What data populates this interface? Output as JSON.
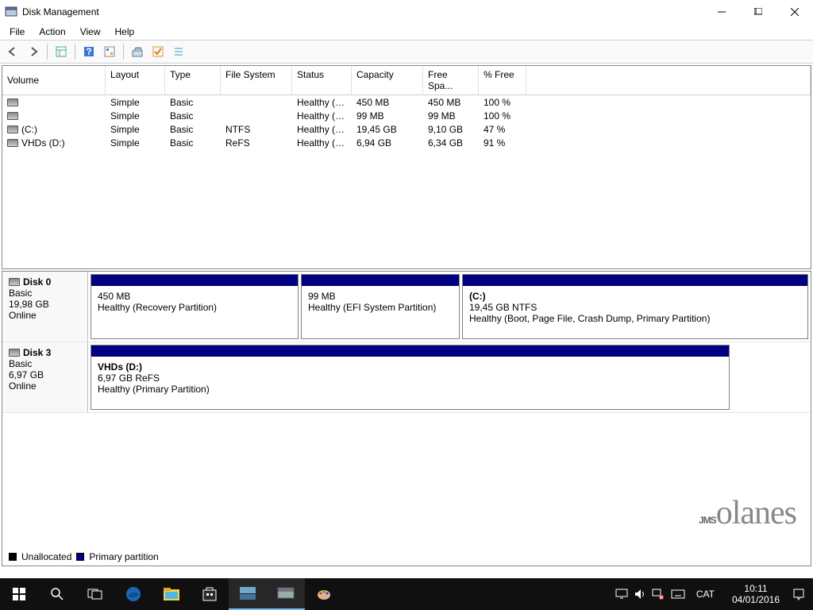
{
  "titlebar": {
    "title": "Disk Management"
  },
  "menu": {
    "file": "File",
    "action": "Action",
    "view": "View",
    "help": "Help"
  },
  "columns": {
    "volume": "Volume",
    "layout": "Layout",
    "type": "Type",
    "fs": "File System",
    "status": "Status",
    "capacity": "Capacity",
    "free": "Free Spa...",
    "pct": "% Free"
  },
  "volumes": [
    {
      "name": "",
      "layout": "Simple",
      "type": "Basic",
      "fs": "",
      "status": "Healthy (R...",
      "capacity": "450 MB",
      "free": "450 MB",
      "pct": "100 %"
    },
    {
      "name": "",
      "layout": "Simple",
      "type": "Basic",
      "fs": "",
      "status": "Healthy (E...",
      "capacity": "99 MB",
      "free": "99 MB",
      "pct": "100 %"
    },
    {
      "name": "(C:)",
      "layout": "Simple",
      "type": "Basic",
      "fs": "NTFS",
      "status": "Healthy (B...",
      "capacity": "19,45 GB",
      "free": "9,10 GB",
      "pct": "47 %"
    },
    {
      "name": "VHDs (D:)",
      "layout": "Simple",
      "type": "Basic",
      "fs": "ReFS",
      "status": "Healthy (P...",
      "capacity": "6,94 GB",
      "free": "6,34 GB",
      "pct": "91 %"
    }
  ],
  "disks": {
    "d0": {
      "label": "Disk 0",
      "type": "Basic",
      "size": "19,98 GB",
      "state": "Online",
      "p0": {
        "title": "",
        "line1": "450 MB",
        "line2": "Healthy (Recovery Partition)"
      },
      "p1": {
        "title": "",
        "line1": "99 MB",
        "line2": "Healthy (EFI System Partition)"
      },
      "p2": {
        "title": "(C:)",
        "line1": "19,45 GB NTFS",
        "line2": "Healthy (Boot, Page File, Crash Dump, Primary Partition)"
      }
    },
    "d3": {
      "label": "Disk 3",
      "type": "Basic",
      "size": "6,97 GB",
      "state": "Online",
      "p0": {
        "title": "VHDs  (D:)",
        "line1": "6,97 GB ReFS",
        "line2": "Healthy (Primary Partition)"
      }
    }
  },
  "legend": {
    "unalloc": "Unallocated",
    "primary": "Primary partition"
  },
  "watermark": "JMSolanes",
  "tray": {
    "lang": "CAT",
    "time": "10:11",
    "date": "04/01/2016"
  }
}
